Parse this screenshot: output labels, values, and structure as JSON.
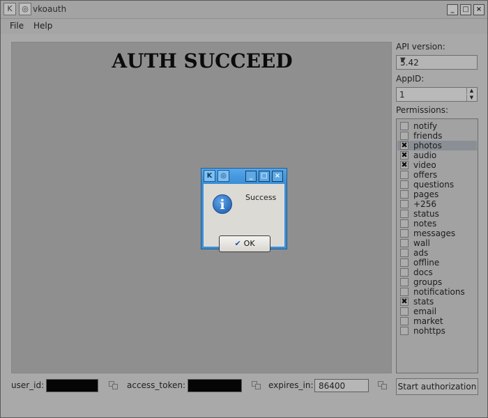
{
  "window": {
    "title": "vkoauth",
    "app_icon": "vk-logo-icon",
    "menu_icon": "window-menu-icon",
    "controls": {
      "minimize": "minimize-icon",
      "maximize": "maximize-icon",
      "close": "close-icon"
    }
  },
  "menu": {
    "file": "File",
    "help": "Help"
  },
  "webview": {
    "heading": "AUTH SUCCEED"
  },
  "settings": {
    "api_version_label": "API version:",
    "api_version_value": "5.42",
    "appid_label": "AppID:",
    "appid_value": "1",
    "permissions_label": "Permissions:"
  },
  "permissions": [
    {
      "label": "notify",
      "checked": false
    },
    {
      "label": "friends",
      "checked": false
    },
    {
      "label": "photos",
      "checked": true,
      "selected": true
    },
    {
      "label": "audio",
      "checked": true
    },
    {
      "label": "video",
      "checked": true
    },
    {
      "label": "offers",
      "checked": false
    },
    {
      "label": "questions",
      "checked": false
    },
    {
      "label": "pages",
      "checked": false
    },
    {
      "label": "+256",
      "checked": false
    },
    {
      "label": "status",
      "checked": false
    },
    {
      "label": "notes",
      "checked": false
    },
    {
      "label": "messages",
      "checked": false
    },
    {
      "label": "wall",
      "checked": false
    },
    {
      "label": "ads",
      "checked": false
    },
    {
      "label": "offline",
      "checked": false
    },
    {
      "label": "docs",
      "checked": false
    },
    {
      "label": "groups",
      "checked": false
    },
    {
      "label": "notifications",
      "checked": false
    },
    {
      "label": "stats",
      "checked": true
    },
    {
      "label": "email",
      "checked": false
    },
    {
      "label": "market",
      "checked": false
    },
    {
      "label": "nohttps",
      "checked": false
    }
  ],
  "bottom": {
    "user_id_label": "user_id:",
    "user_id_value": "",
    "access_token_label": "access_token:",
    "access_token_value": "",
    "expires_in_label": "expires_in:",
    "expires_in_value": "86400",
    "start_button": "Start authorization"
  },
  "dialog": {
    "icon": "info-icon",
    "message": "Success",
    "ok_label": "OK"
  }
}
